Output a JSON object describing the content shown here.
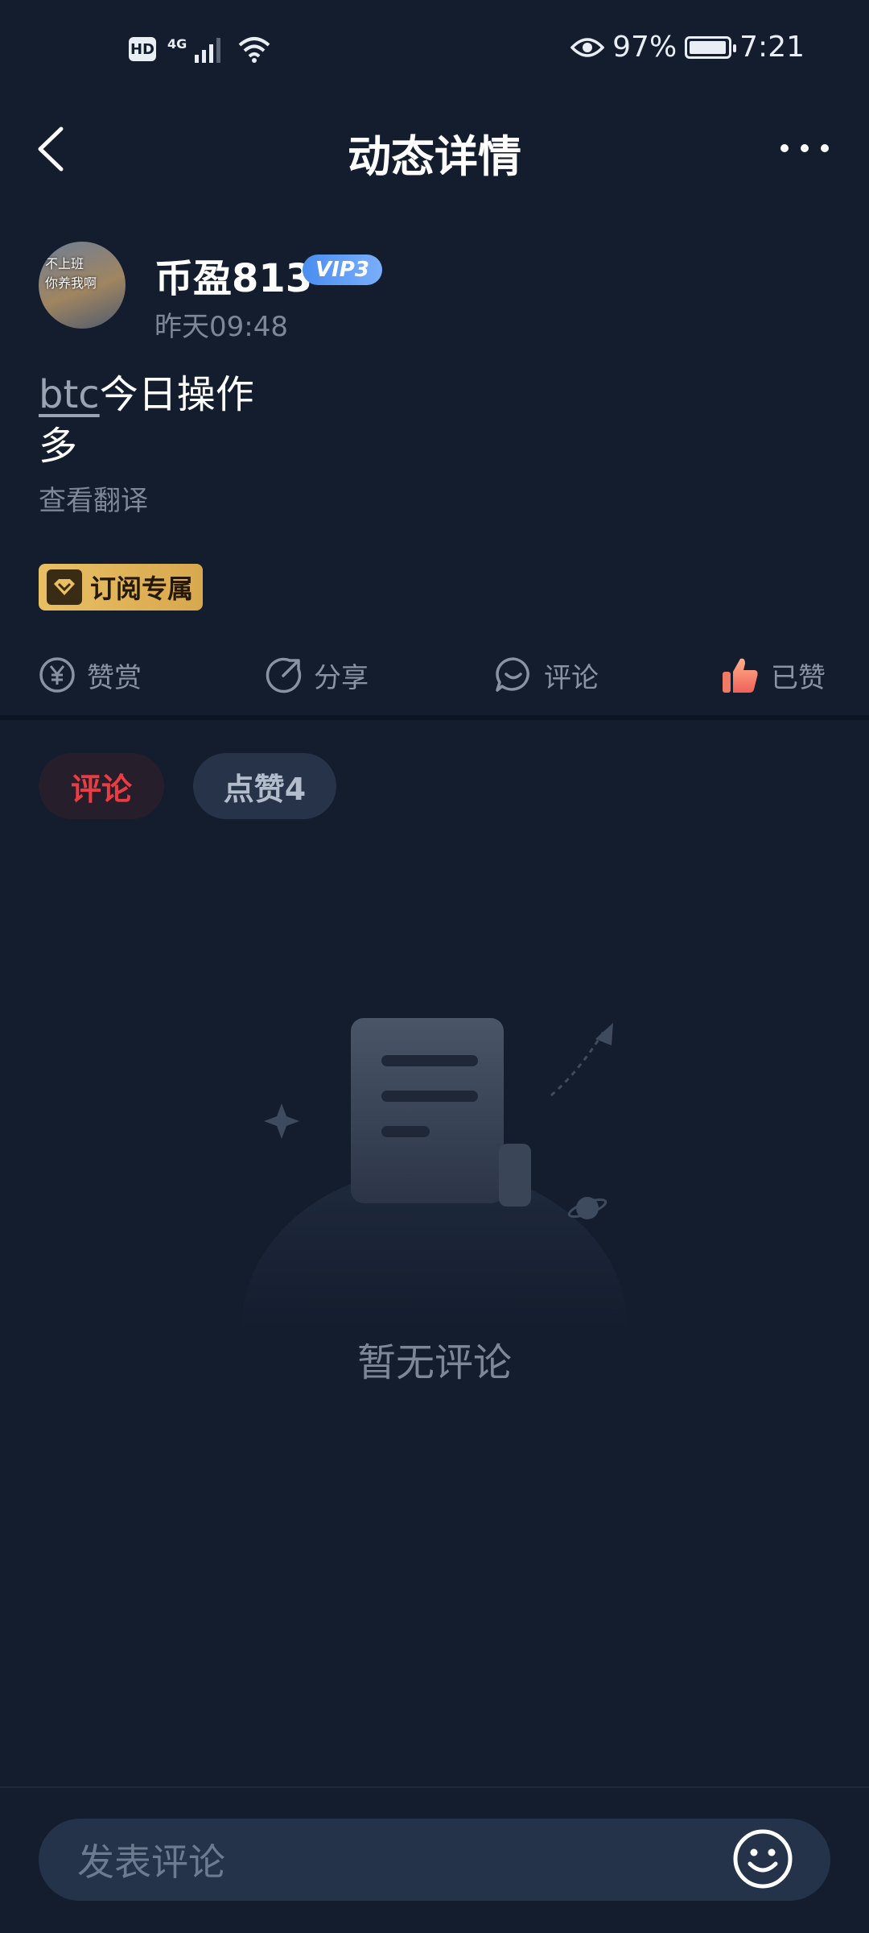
{
  "status_bar": {
    "hd": "HD",
    "network": "4G",
    "battery_percent": "97%",
    "battery_level": 0.97,
    "time": "7:21"
  },
  "header": {
    "title": "动态详情"
  },
  "post": {
    "author": "币盈813",
    "vip_label": "VIP3",
    "avatar_text_1": "不上班",
    "avatar_text_2": "你养我啊",
    "time": "昨天09:48",
    "tag": "btc",
    "line1_text": "今日操作",
    "line2_text": "多",
    "translate_label": "查看翻译",
    "subscribe_badge": "订阅专属"
  },
  "actions": {
    "reward": "赞赏",
    "share": "分享",
    "comment": "评论",
    "liked": "已赞"
  },
  "tabs": {
    "comments": "评论",
    "likes": "点赞4"
  },
  "empty_state": {
    "text": "暂无评论"
  },
  "composer": {
    "placeholder": "发表评论"
  },
  "colors": {
    "background": "#141d2e",
    "accent_red": "#ea3c43",
    "vip_blue": "#4a8ef0",
    "gold": "#e9bf63"
  }
}
